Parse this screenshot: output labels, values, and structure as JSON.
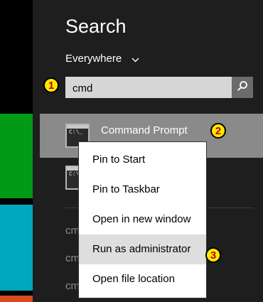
{
  "search": {
    "title": "Search",
    "scope_label": "Everywhere",
    "query": "cmd"
  },
  "results": {
    "primary_label": "Command Prompt",
    "partial_labels": [
      "cmd",
      "cmd",
      "cmd"
    ],
    "cmd_icon_text": "C:\\_"
  },
  "context_menu": {
    "items": [
      "Pin to Start",
      "Pin to Taskbar",
      "Open in new window",
      "Run as administrator",
      "Open file location"
    ]
  },
  "badges": [
    "1",
    "2",
    "3"
  ],
  "colors": {
    "tile_green": "#009a16",
    "tile_teal": "#00a7bf",
    "tile_orange": "#d84a1f",
    "badge_fill": "#ffea00",
    "badge_text": "#c00000",
    "selected_row": "#8a8a8a",
    "menu_highlight": "#dedede"
  }
}
